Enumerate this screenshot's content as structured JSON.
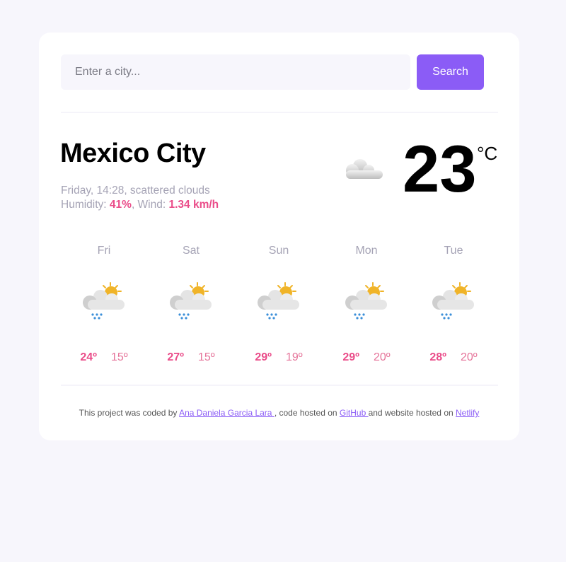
{
  "search": {
    "placeholder": "Enter a city...",
    "button_label": "Search"
  },
  "current": {
    "city": "Mexico City",
    "datetime_desc": "Friday, 14:28, scattered clouds",
    "humidity_label": "Humidity: ",
    "humidity_value": "41%",
    "wind_label": ", Wind: ",
    "wind_value": "1.34 km/h",
    "temperature": "23",
    "unit": "°C",
    "icon": "scattered-clouds-icon"
  },
  "forecast": [
    {
      "day": "Fri",
      "max": "24º",
      "min": "15º",
      "icon": "sun-cloud-rain-icon"
    },
    {
      "day": "Sat",
      "max": "27º",
      "min": "15º",
      "icon": "sun-cloud-rain-icon"
    },
    {
      "day": "Sun",
      "max": "29º",
      "min": "19º",
      "icon": "sun-cloud-rain-icon"
    },
    {
      "day": "Mon",
      "max": "29º",
      "min": "20º",
      "icon": "sun-cloud-rain-icon"
    },
    {
      "day": "Tue",
      "max": "28º",
      "min": "20º",
      "icon": "sun-cloud-rain-icon"
    }
  ],
  "footer": {
    "text1": "This project was coded by ",
    "author_link": "Ana Daniela Garcia Lara ",
    "text2": ", code hosted on ",
    "github_link": "GitHub ",
    "text3": "and website hosted on ",
    "netlify_link": "Netlify"
  },
  "colors": {
    "accent": "#8b5cf6",
    "highlight": "#ea4c89",
    "muted": "#a5a3b5",
    "background": "#f7f6fc"
  }
}
